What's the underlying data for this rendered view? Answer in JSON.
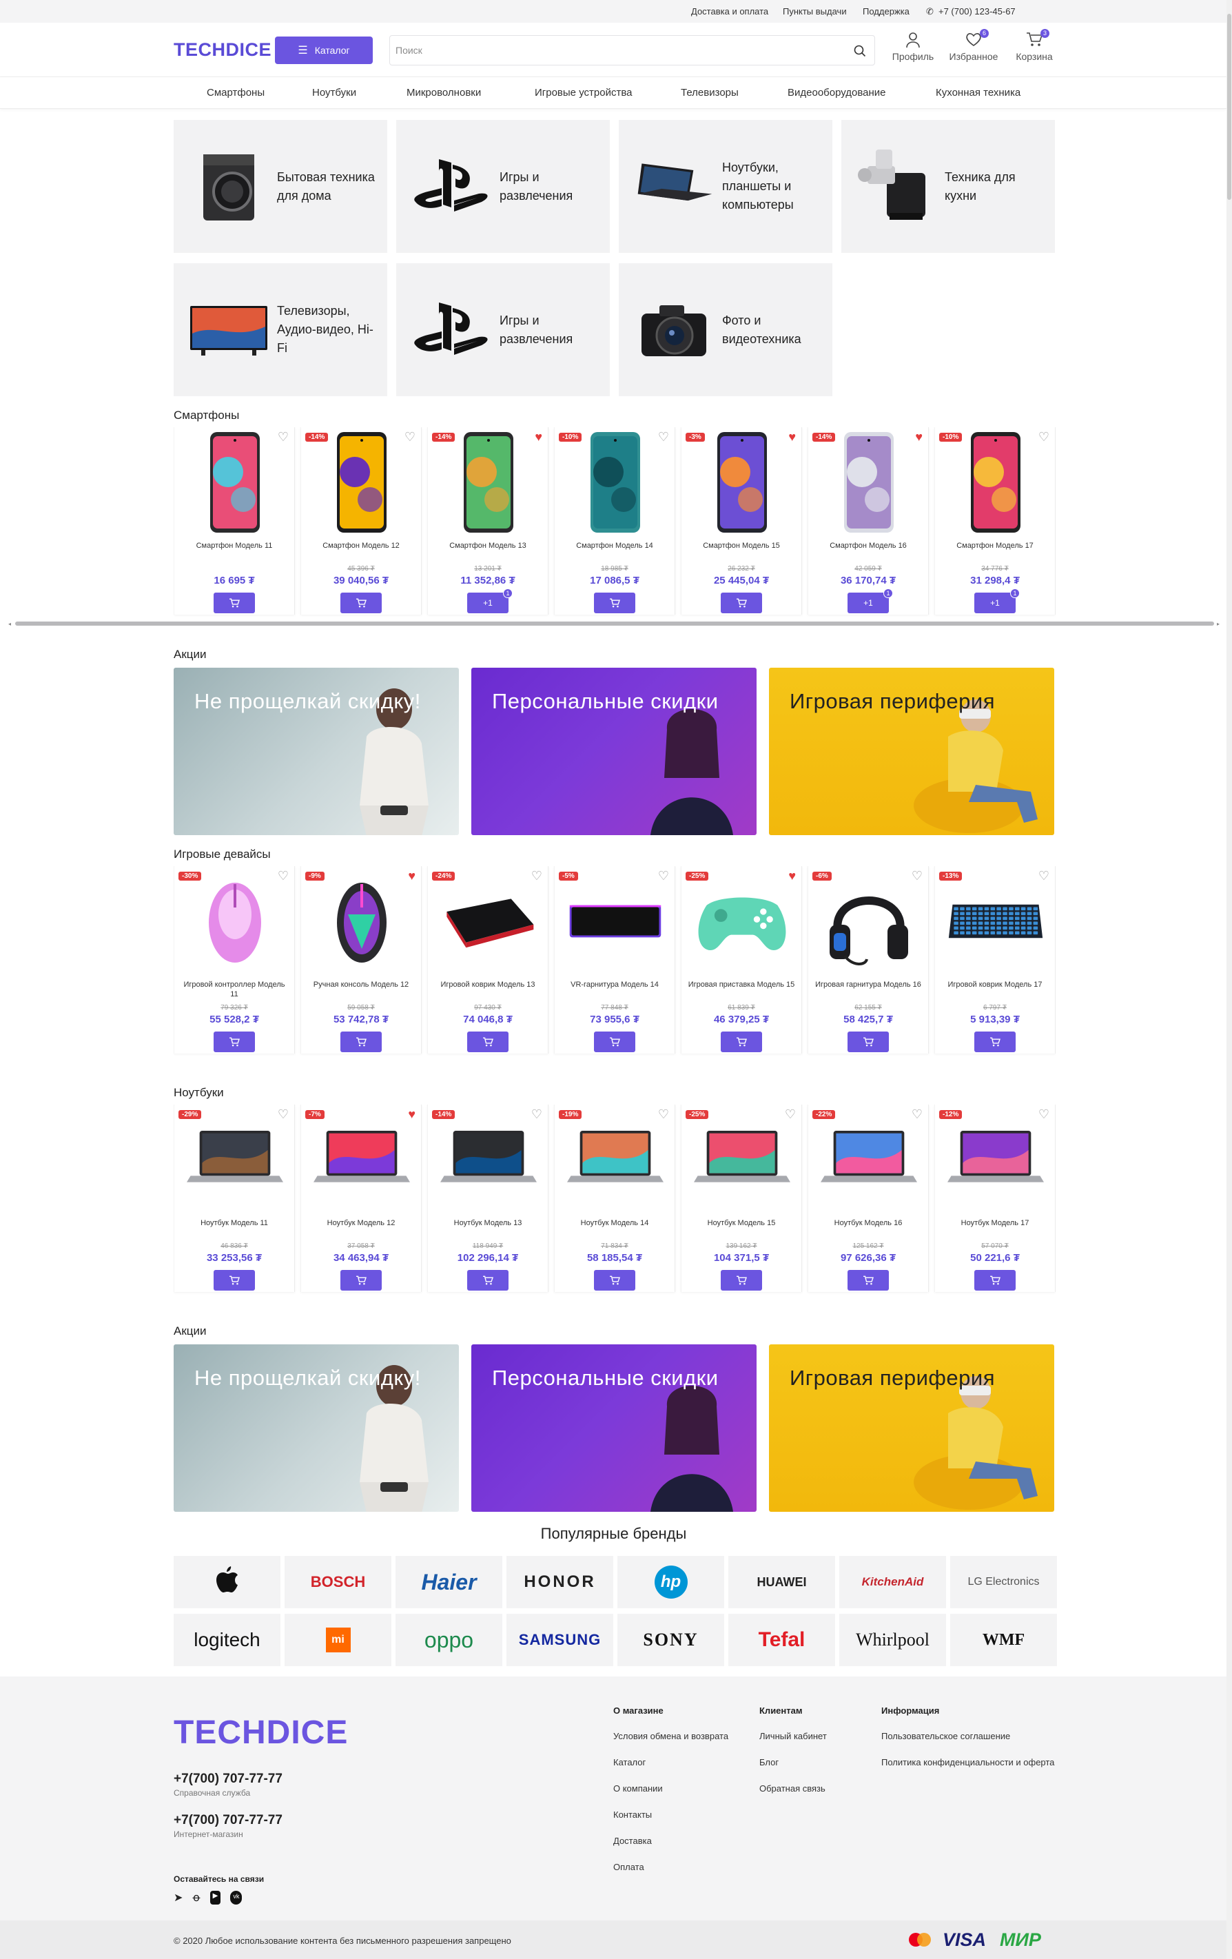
{
  "topbar": {
    "links": [
      "Доставка и оплата",
      "Пункты выдачи",
      "Поддержка"
    ],
    "phone": "+7 (700) 123-45-67"
  },
  "header": {
    "logo": "TECHDICE",
    "catalog_label": "Каталог",
    "search_placeholder": "Поиск",
    "profile_label": "Профиль",
    "favorites_label": "Избранное",
    "favorites_count": "6",
    "cart_label": "Корзина",
    "cart_count": "3"
  },
  "nav": [
    "Смартфоны",
    "Ноутбуки",
    "Микроволновки",
    "Игровые устройства",
    "Телевизоры",
    "Видеооборудование",
    "Кухонная техника"
  ],
  "categories": [
    {
      "label": "Бытовая техника для дома",
      "icon": "washer"
    },
    {
      "label": "Игры и развлечения",
      "icon": "playstation"
    },
    {
      "label": "Ноутбуки, планшеты и компьютеры",
      "icon": "laptop"
    },
    {
      "label": "Техника для кухни",
      "icon": "meat-grinder"
    },
    {
      "label": "Телевизоры, Аудио-видео, Hi-Fi",
      "icon": "tv"
    },
    {
      "label": "Игры и развлечения",
      "icon": "playstation"
    },
    {
      "label": "Фото и видеотехника",
      "icon": "camera"
    }
  ],
  "smartphones": {
    "title": "Смартфоны",
    "items": [
      {
        "name": "Смартфон Модель 11",
        "discount": "",
        "old": "",
        "price": "16 695 ₮",
        "fav": false,
        "in_cart": ""
      },
      {
        "name": "Смартфон Модель 12",
        "discount": "-14%",
        "old": "45 396 ₮",
        "price": "39 040,56 ₮",
        "fav": false,
        "in_cart": ""
      },
      {
        "name": "Смартфон Модель 13",
        "discount": "-14%",
        "old": "13 201 ₮",
        "price": "11 352,86 ₮",
        "fav": true,
        "in_cart": "1"
      },
      {
        "name": "Смартфон Модель 14",
        "discount": "-10%",
        "old": "18 985 ₮",
        "price": "17 086,5 ₮",
        "fav": false,
        "in_cart": ""
      },
      {
        "name": "Смартфон Модель 15",
        "discount": "-3%",
        "old": "26 232 ₮",
        "price": "25 445,04 ₮",
        "fav": true,
        "in_cart": ""
      },
      {
        "name": "Смартфон Модель 16",
        "discount": "-14%",
        "old": "42 059 ₮",
        "price": "36 170,74 ₮",
        "fav": true,
        "in_cart": "1"
      },
      {
        "name": "Смартфон Модель 17",
        "discount": "-10%",
        "old": "34 776 ₮",
        "price": "31 298,4 ₮",
        "fav": false,
        "in_cart": "1"
      }
    ]
  },
  "promo": {
    "title": "Акции",
    "banners": [
      "Не прощелкай скидку!",
      "Персональные скидки",
      "Игровая периферия"
    ]
  },
  "gaming": {
    "title": "Игровые девайсы",
    "items": [
      {
        "name": "Игровой контроллер Модель 11",
        "discount": "-30%",
        "old": "79 326 ₮",
        "price": "55 528,2 ₮",
        "fav": false
      },
      {
        "name": "Ручная консоль Модель 12",
        "discount": "-9%",
        "old": "59 058 ₮",
        "price": "53 742,78 ₮",
        "fav": true
      },
      {
        "name": "Игровой коврик Модель 13",
        "discount": "-24%",
        "old": "97 430 ₮",
        "price": "74 046,8 ₮",
        "fav": false
      },
      {
        "name": "VR-гарнитура Модель 14",
        "discount": "-5%",
        "old": "77 848 ₮",
        "price": "73 955,6 ₮",
        "fav": false
      },
      {
        "name": "Игровая приставка Модель 15",
        "discount": "-25%",
        "old": "61 839 ₮",
        "price": "46 379,25 ₮",
        "fav": true
      },
      {
        "name": "Игровая гарнитура Модель 16",
        "discount": "-6%",
        "old": "62 155 ₮",
        "price": "58 425,7 ₮",
        "fav": false
      },
      {
        "name": "Игровой коврик Модель 17",
        "discount": "-13%",
        "old": "6 797 ₮",
        "price": "5 913,39 ₮",
        "fav": false
      }
    ]
  },
  "laptops": {
    "title": "Ноутбуки",
    "items": [
      {
        "name": "Ноутбук Модель 11",
        "discount": "-29%",
        "old": "46 836 ₮",
        "price": "33 253,56 ₮",
        "fav": false
      },
      {
        "name": "Ноутбук Модель 12",
        "discount": "-7%",
        "old": "37 058 ₮",
        "price": "34 463,94 ₮",
        "fav": true
      },
      {
        "name": "Ноутбук Модель 13",
        "discount": "-14%",
        "old": "118 949 ₮",
        "price": "102 296,14 ₮",
        "fav": false
      },
      {
        "name": "Ноутбук Модель 14",
        "discount": "-19%",
        "old": "71 834 ₮",
        "price": "58 185,54 ₮",
        "fav": false
      },
      {
        "name": "Ноутбук Модель 15",
        "discount": "-25%",
        "old": "139 162 ₮",
        "price": "104 371,5 ₮",
        "fav": false
      },
      {
        "name": "Ноутбук Модель 16",
        "discount": "-22%",
        "old": "125 162 ₮",
        "price": "97 626,36 ₮",
        "fav": false
      },
      {
        "name": "Ноутбук Модель 17",
        "discount": "-12%",
        "old": "57 070 ₮",
        "price": "50 221,6 ₮",
        "fav": false
      }
    ]
  },
  "promo2": {
    "title": "Акции"
  },
  "brands": {
    "title": "Популярные бренды",
    "items": [
      "Apple",
      "BOSCH",
      "Haier",
      "HONOR",
      "hp",
      "HUAWEI",
      "KitchenAid",
      "LG Electronics",
      "logitech",
      "mi",
      "oppo",
      "SAMSUNG",
      "SONY",
      "Tefal",
      "Whirlpool",
      "WMF"
    ]
  },
  "footer": {
    "logo": "TECHDICE",
    "phone1": "+7(700) 707-77-77",
    "phone1_caption": "Справочная служба",
    "phone2": "+7(700) 707-77-77",
    "phone2_caption": "Интернет-магазин",
    "social_title": "Оставайтесь на связи",
    "cols": [
      {
        "title": "О магазине",
        "links": [
          "Условия обмена и возврата",
          "Каталог",
          "О компании",
          "Контакты",
          "Доставка",
          "Оплата"
        ]
      },
      {
        "title": "Клиентам",
        "links": [
          "Личный кабинет",
          "Блог",
          "Обратная связь"
        ]
      },
      {
        "title": "Информация",
        "links": [
          "Пользовательское соглашение",
          "Политика конфиденциальности и оферта"
        ]
      }
    ],
    "copyright": "© 2020 Любое использование контента без письменного разрешения запрещено",
    "payments": [
      "VISA",
      "МИР"
    ]
  }
}
